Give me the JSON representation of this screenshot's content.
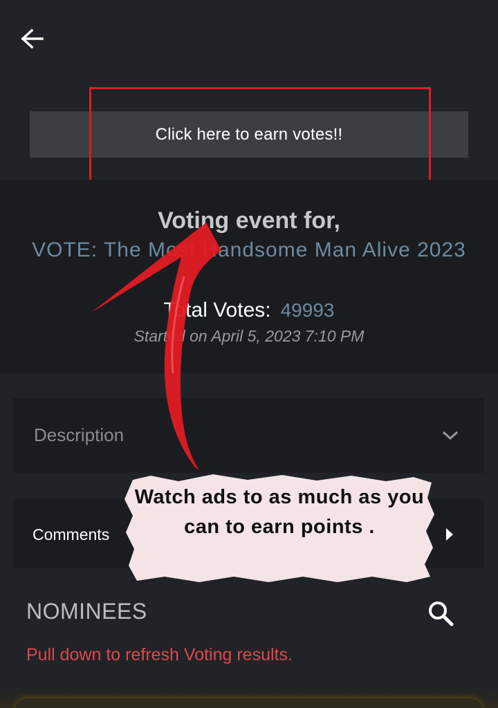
{
  "header": {
    "back_icon": "arrow-left-icon"
  },
  "earn": {
    "label": "Click here to earn votes!!"
  },
  "event": {
    "title": "Voting event for,",
    "name": "VOTE: The Most Handsome Man Alive 2023",
    "total_votes_label": "Total Votes:",
    "total_votes_value": "49993",
    "started": "Started on April 5, 2023 7:10 PM"
  },
  "sections": {
    "description_label": "Description",
    "description_icon": "chevron-down-icon",
    "comments_label": "Comments",
    "comments_icon": "caret-right-icon"
  },
  "nominees": {
    "title": "NOMINEES",
    "search_icon": "search-icon",
    "refresh_note": "Pull down to refresh Voting results."
  },
  "annotation": {
    "callout_text": "Watch ads to as much as you can to earn points .",
    "highlight_color": "#e01b24",
    "arrow_color": "#e01b24"
  },
  "colors": {
    "background": "#202327",
    "panel": "#1a1c20",
    "accent_blue": "#6c8ba0",
    "warning_red": "#e0474c"
  }
}
